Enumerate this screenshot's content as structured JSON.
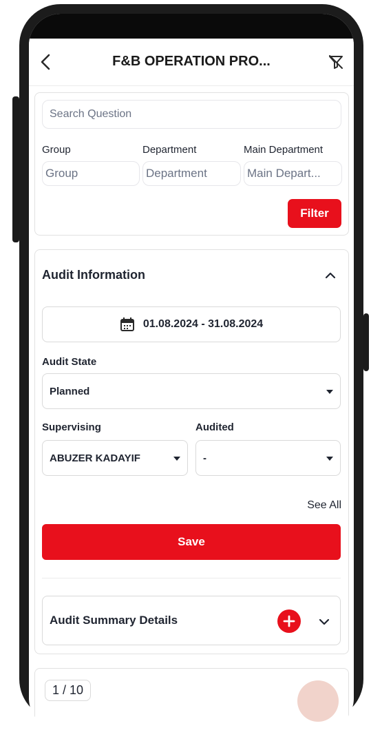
{
  "header": {
    "title": "F&B OPERATION PRO...",
    "back_icon": "chevron-left-icon",
    "filter_off_icon": "filter-off-icon"
  },
  "filters": {
    "search_placeholder": "Search Question",
    "group_label": "Group",
    "group_placeholder": "Group",
    "department_label": "Department",
    "department_placeholder": "Department",
    "main_department_label": "Main Department",
    "main_department_placeholder": "Main Depart...",
    "filter_button": "Filter"
  },
  "audit_info": {
    "title": "Audit Information",
    "date_range": "01.08.2024 - 31.08.2024",
    "audit_state_label": "Audit State",
    "audit_state_value": "Planned",
    "supervising_label": "Supervising",
    "supervising_value": "ABUZER KADAYIF",
    "audited_label": "Audited",
    "audited_value": "-",
    "see_all": "See All",
    "save_button": "Save"
  },
  "summary": {
    "title": "Audit Summary Details"
  },
  "pagination": {
    "page": "1 / 10"
  },
  "colors": {
    "accent": "#e8101c",
    "frame": "#1c1c1c",
    "fab": "#f1d3cb"
  }
}
